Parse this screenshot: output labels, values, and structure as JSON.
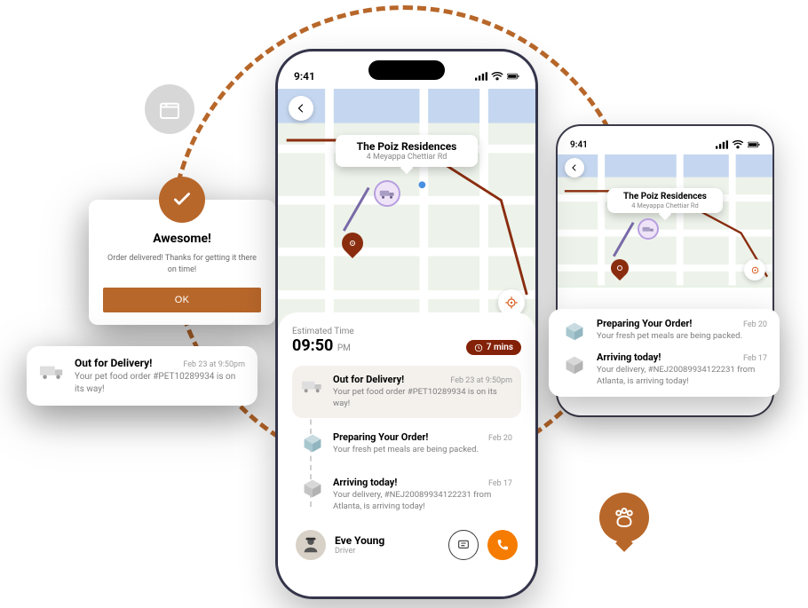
{
  "statusbar": {
    "time": "9:41"
  },
  "map": {
    "destination": {
      "title": "The Poiz Residences",
      "subtitle": "4 Meyappa Chettiar Rd"
    }
  },
  "sheet": {
    "est_label": "Estimated Time",
    "est_time": "09:50",
    "est_suffix": "PM",
    "eta_chip": "7 mins",
    "items": [
      {
        "title": "Out for Delivery!",
        "date": "Feb 23 at 9:50pm",
        "desc": "Your pet food order #PET10289934 is on its way!"
      },
      {
        "title": "Preparing Your Order!",
        "date": "Feb 20",
        "desc": "Your fresh pet meals are being packed."
      },
      {
        "title": "Arriving today!",
        "date": "Feb 17",
        "desc": "Your delivery, #NEJ20089934122231 from Atlanta, is arriving today!"
      }
    ]
  },
  "driver": {
    "name": "Eve Young",
    "role": "Driver"
  },
  "modal": {
    "title": "Awesome!",
    "body": "Order delivered! Thanks for getting it there on time!",
    "ok": "OK"
  },
  "left_card": {
    "title": "Out for Delivery!",
    "date": "Feb 23 at 9:50pm",
    "desc": "Your pet food order #PET10289934 is on its way!"
  },
  "mini": {
    "time": "9:41",
    "dest_title": "The Poiz Residences",
    "dest_sub": "4 Meyappa Chettiar Rd"
  },
  "right_card": {
    "items": [
      {
        "title": "Preparing Your Order!",
        "date": "Feb 20",
        "desc": "Your fresh pet meals are being packed."
      },
      {
        "title": "Arriving today!",
        "date": "Feb 17",
        "desc": "Your delivery, #NEJ20089934122231 from Atlanta, is arriving today!"
      }
    ]
  }
}
